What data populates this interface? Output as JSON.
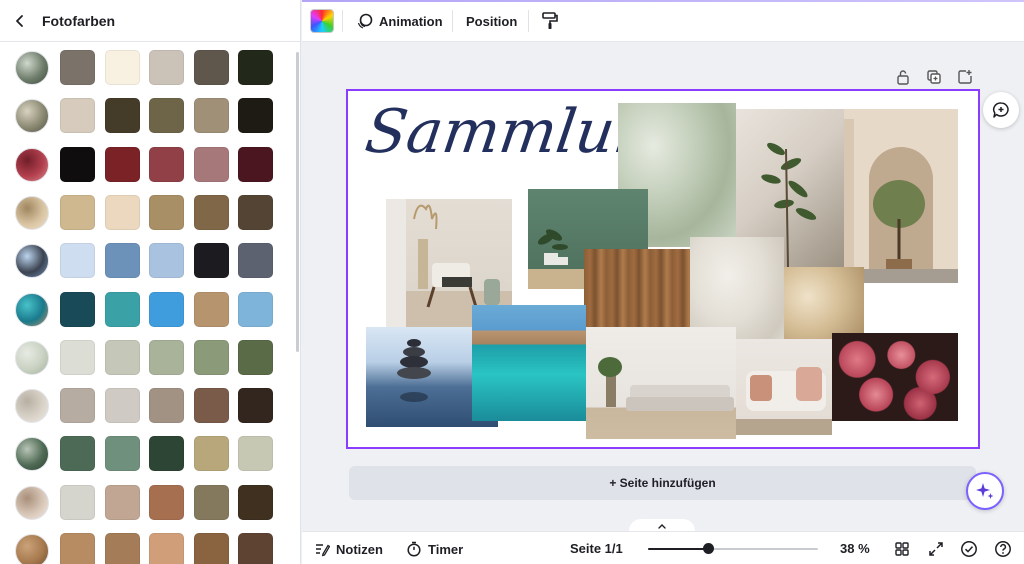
{
  "panel": {
    "title": "Fotofarben",
    "rows": [
      {
        "photo_colors": [
          "#6f7d6c",
          "#cfd8cb",
          "#3d4a38"
        ],
        "colors": [
          "#7b726a",
          "#f8f0e0",
          "#cbc3b8",
          "#5f574c",
          "#22281a"
        ]
      },
      {
        "photo_colors": [
          "#8c8a73",
          "#d8d2c0",
          "#4f5442"
        ],
        "colors": [
          "#d6cbbd",
          "#443b28",
          "#6e6549",
          "#a09078",
          "#1d1b14"
        ]
      },
      {
        "photo_colors": [
          "#b3404e",
          "#701e29",
          "#d98a90"
        ],
        "colors": [
          "#0f0d0e",
          "#7a2226",
          "#904046",
          "#a6787a",
          "#4b1620"
        ]
      },
      {
        "photo_colors": [
          "#d9c4a2",
          "#a08660",
          "#efe3cf"
        ],
        "colors": [
          "#cfb78f",
          "#ecd8bf",
          "#a88f65",
          "#7f6748",
          "#544434"
        ]
      },
      {
        "photo_colors": [
          "#3b4350",
          "#bcd4ef",
          "#6f8fb8"
        ],
        "colors": [
          "#cfddf0",
          "#6d92ba",
          "#a8c2e0",
          "#1c1c20",
          "#5c6270"
        ]
      },
      {
        "photo_colors": [
          "#1a7a8c",
          "#48c2c9",
          "#b98f66"
        ],
        "colors": [
          "#194a58",
          "#3aa2a6",
          "#3f9ddd",
          "#b6946e",
          "#7fb4da"
        ]
      },
      {
        "photo_colors": [
          "#c9d2c2",
          "#e7ebe3",
          "#a4b09c"
        ],
        "colors": [
          "#dcddd5",
          "#c5c8b8",
          "#a8b39a",
          "#8b9a79",
          "#5a6b47"
        ]
      },
      {
        "photo_colors": [
          "#d8d2c8",
          "#b8afa2",
          "#efebe5"
        ],
        "colors": [
          "#b7aca2",
          "#cfcac4",
          "#a19284",
          "#7a5b4a",
          "#33261e"
        ]
      },
      {
        "photo_colors": [
          "#4f6b55",
          "#b8c4b6",
          "#2e4330"
        ],
        "colors": [
          "#4d6a56",
          "#6e907c",
          "#2d4534",
          "#b8a77b",
          "#c7c8b4"
        ]
      },
      {
        "photo_colors": [
          "#d8c7b8",
          "#a98f7a",
          "#f2ebe3"
        ],
        "colors": [
          "#d6d5cd",
          "#c0a693",
          "#a66f50",
          "#85795d",
          "#3f3020"
        ]
      },
      {
        "photo_colors": [
          "#a77a4e",
          "#cba27a",
          "#6f4d2e"
        ],
        "colors": [
          "#b88c63",
          "#a57c58",
          "#d09f79",
          "#8a6340",
          "#5e4332"
        ]
      }
    ]
  },
  "toolbar": {
    "animation_label": "Animation",
    "position_label": "Position"
  },
  "canvas": {
    "title_text": "Sammlung"
  },
  "add_page_label": "+ Seite hinzufügen",
  "bottombar": {
    "notes_label": "Notizen",
    "timer_label": "Timer",
    "page_indicator": "Seite 1/1",
    "zoom_label": "38 %",
    "zoom_fraction": 0.35
  },
  "icons": {
    "back": "chevron-left-icon",
    "color": "color-palette-icon",
    "animation": "animation-icon",
    "paint": "paint-roller-icon",
    "lock": "lock-icon",
    "duplicate": "duplicate-icon",
    "add": "add-page-icon",
    "comment": "comment-icon",
    "magic": "sparkle-icon",
    "notes": "notes-icon",
    "timer": "timer-icon",
    "grid": "grid-view-icon",
    "fullscreen": "fullscreen-icon",
    "check": "check-circle-icon",
    "help": "help-icon"
  }
}
